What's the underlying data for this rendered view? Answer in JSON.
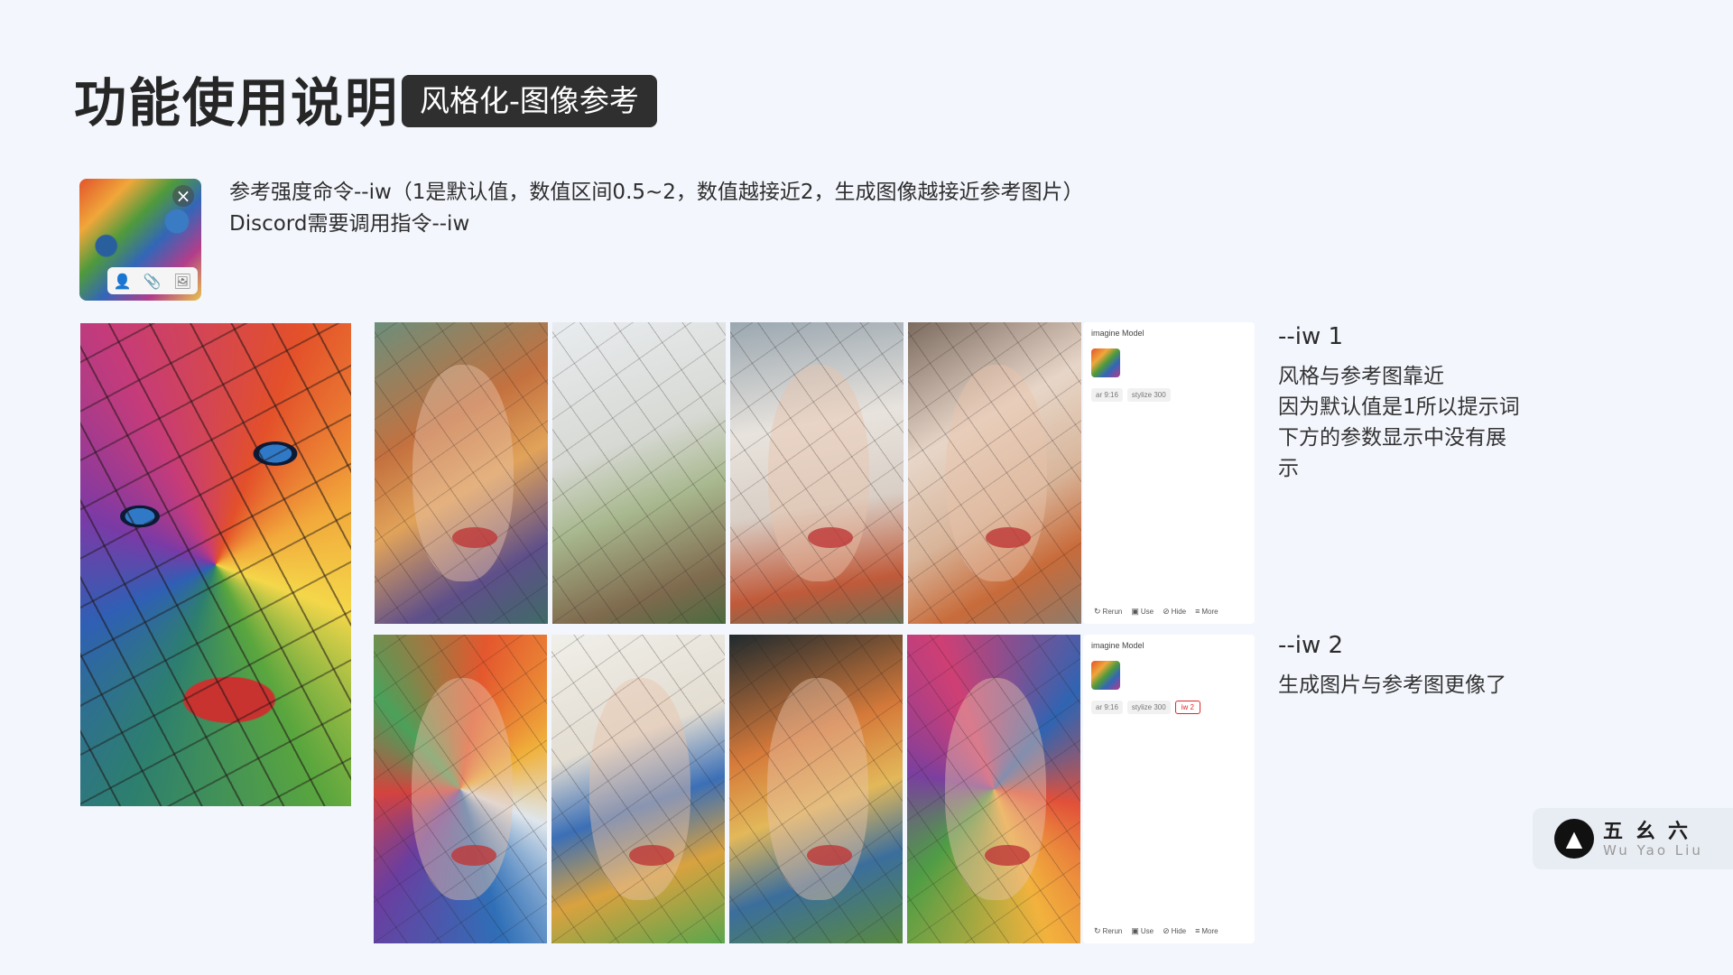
{
  "title": "功能使用说明",
  "title_badge": "风格化-图像参考",
  "description": {
    "line1": "参考强度命令--iw（1是默认值，数值区间0.5~2，数值越接近2，生成图像越接近参考图片）",
    "line2": "Discord需要调用指令--iw"
  },
  "reference_card": {
    "close_icon": "close-icon",
    "tools": [
      "person-icon",
      "paperclip-icon",
      "image-icon"
    ]
  },
  "panels": [
    {
      "title": "imagine Model",
      "chips": [
        "ar 9:16",
        "stylize 300"
      ],
      "actions": [
        "Rerun",
        "Use",
        "Hide",
        "More"
      ]
    },
    {
      "title": "imagine Model",
      "chips": [
        "ar 9:16",
        "stylize 300"
      ],
      "highlight_chip": "iw 2",
      "actions": [
        "Rerun",
        "Use",
        "Hide",
        "More"
      ]
    }
  ],
  "notes": [
    {
      "heading": "--iw 1",
      "lines": [
        "风格与参考图靠近",
        "因为默认值是1所以提示词",
        "下方的参数显示中没有展",
        "示"
      ]
    },
    {
      "heading": "--iw 2",
      "lines": [
        "生成图片与参考图更像了"
      ]
    }
  ],
  "logo": {
    "cn": "五幺六",
    "en": "Wu Yao Liu"
  },
  "colors": {
    "background": "#f3f6fc",
    "badge": "#2f2f2f",
    "highlight": "#e02626"
  }
}
